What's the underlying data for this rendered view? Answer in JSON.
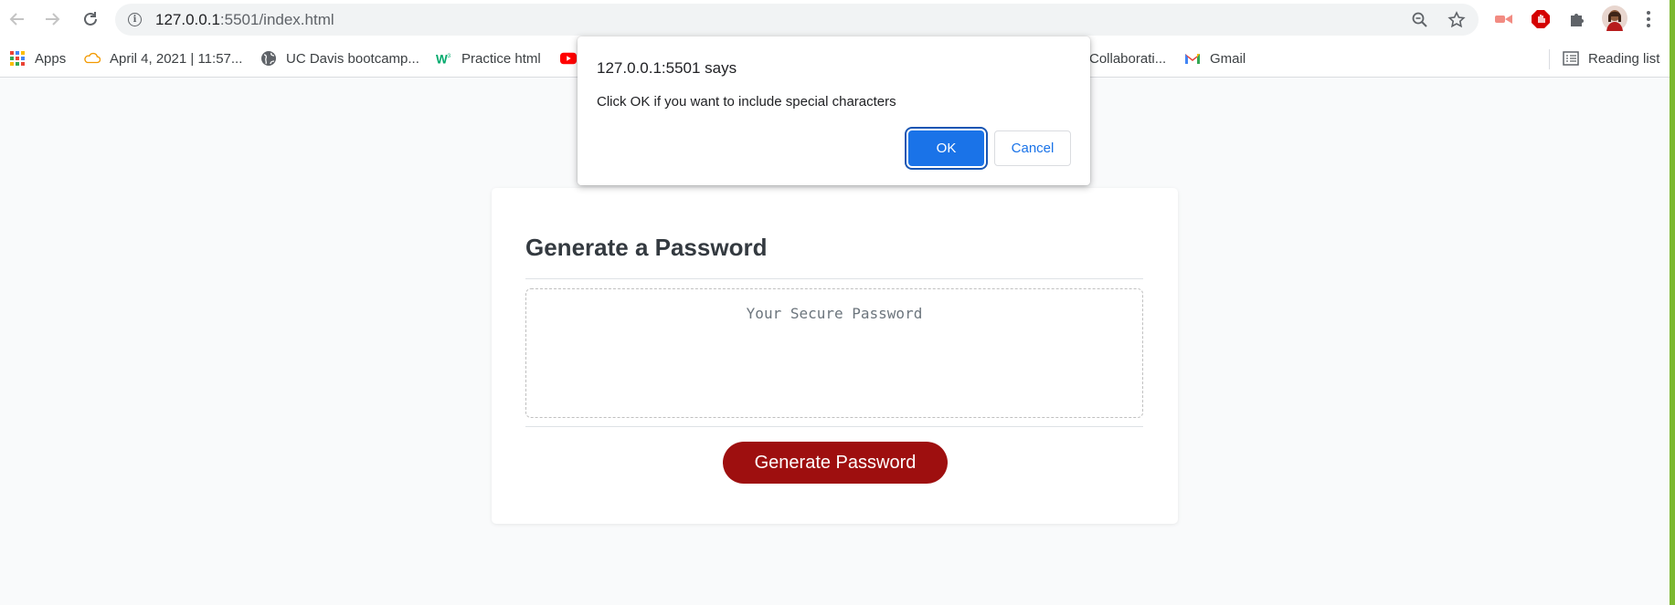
{
  "browser": {
    "url_host": "127.0.0.1",
    "url_path": ":5501/index.html",
    "icons": {
      "back": "back-arrow-icon",
      "forward": "forward-arrow-icon",
      "reload": "reload-icon",
      "info": "site-info-icon",
      "zoom": "zoom-icon",
      "bookmark_star": "bookmark-star-icon",
      "extensions": "puzzle-extensions-icon",
      "menu": "kebab-menu-icon"
    }
  },
  "bookmarks": {
    "items": [
      {
        "label": "Apps",
        "icon": "apps-grid-icon"
      },
      {
        "label": "April 4, 2021 | 11:57...",
        "icon": "cloud-icon"
      },
      {
        "label": "UC Davis bootcamp...",
        "icon": "globe-icon"
      },
      {
        "label": "Practice html",
        "icon": "w3schools-icon"
      },
      {
        "label": "",
        "icon": "youtube-icon"
      },
      {
        "label": "Collaborati...",
        "icon": ""
      },
      {
        "label": "Gmail",
        "icon": "gmail-icon"
      }
    ],
    "reading_list": "Reading list"
  },
  "dialog": {
    "title": "127.0.0.1:5501 says",
    "message": "Click OK if you want to include special characters",
    "ok_label": "OK",
    "cancel_label": "Cancel"
  },
  "card": {
    "title": "Generate a Password",
    "password_placeholder": "Your Secure Password",
    "generate_label": "Generate Password"
  },
  "colors": {
    "accent_blue": "#1a73e8",
    "generate_button": "#9e0f0f",
    "page_background": "#f9fafb",
    "right_edge": "#7cb82f"
  }
}
